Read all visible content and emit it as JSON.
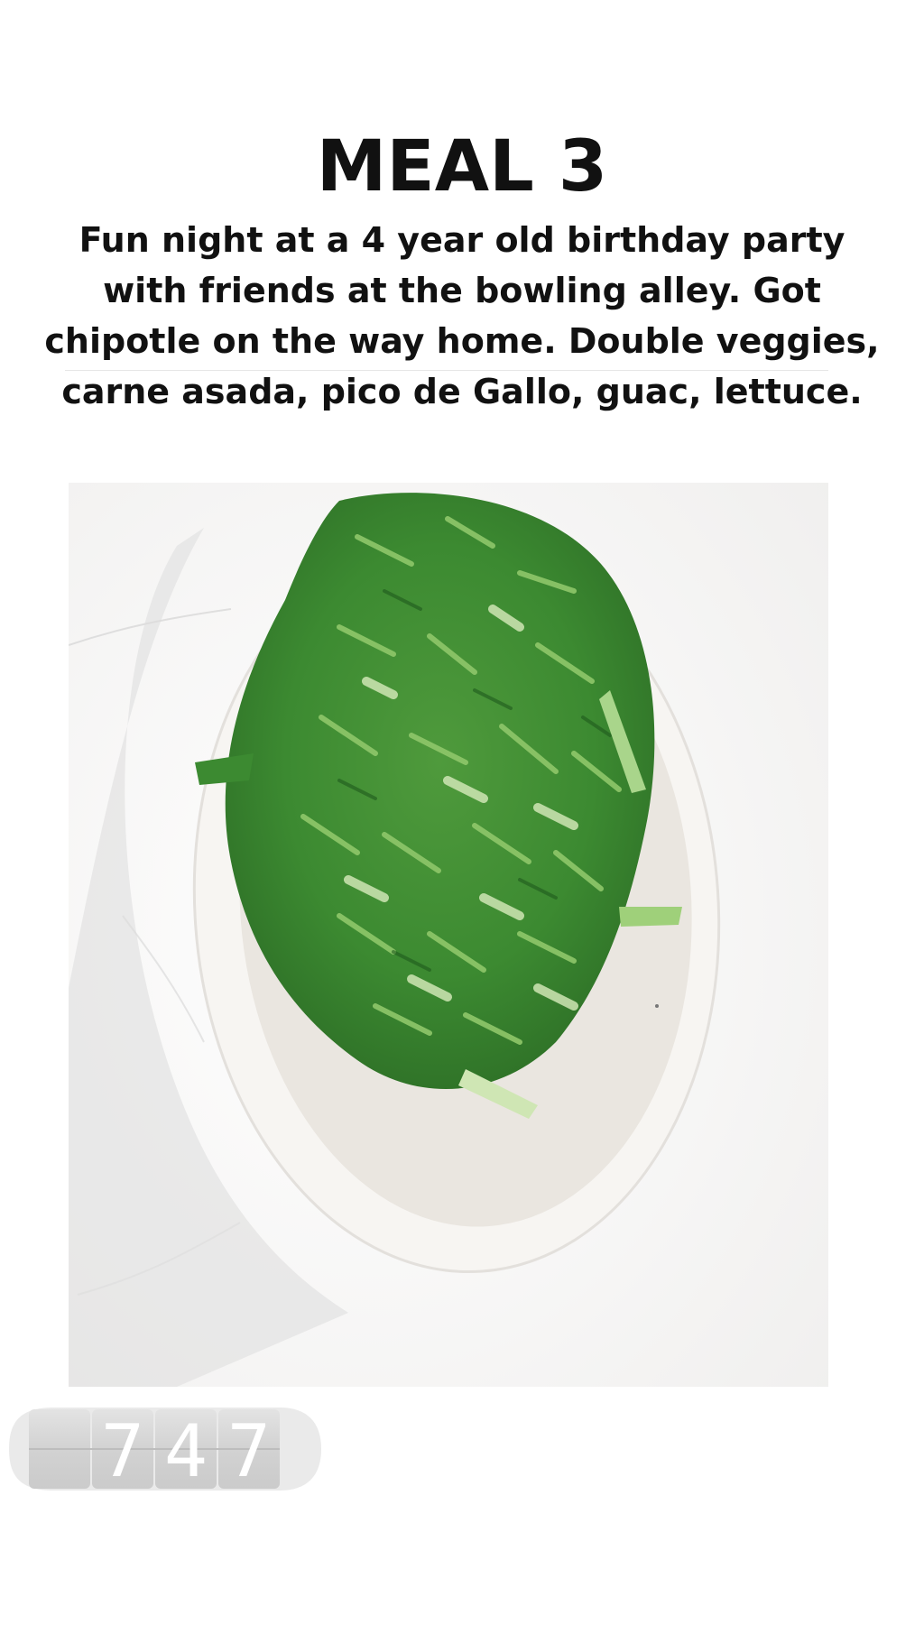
{
  "story": {
    "title": "MEAL 3",
    "caption": "Fun night at a 4 year old birthday party with friends at the bowling alley. Got chipotle on the way home. Double veggies, carne asada, pico de Gallo, guac, lettuce."
  },
  "counter": {
    "digits": [
      "",
      "7",
      "4",
      "7"
    ]
  },
  "colors": {
    "text": "#111111",
    "lettuce_dark": "#2f7a2a",
    "lettuce_light": "#8fc76a",
    "pico": "#c8462e",
    "bowl": "#f7f5f2"
  }
}
